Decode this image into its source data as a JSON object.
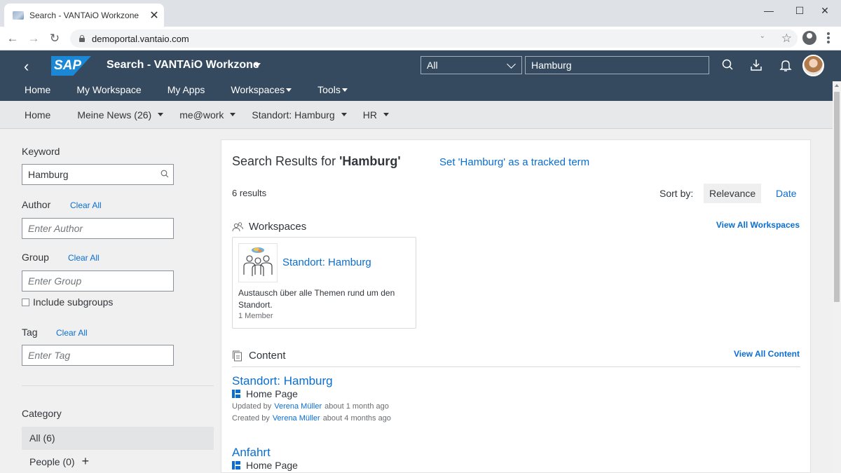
{
  "browser": {
    "tab_title": "Search - VANTAiO Workzone",
    "url": "demoportal.vantaio.com"
  },
  "shell": {
    "title": "Search - VANTAiO Workzone",
    "scope_value": "All",
    "search_value": "Hamburg",
    "logo_text": "SAP",
    "nav": [
      {
        "label": "Home"
      },
      {
        "label": "My Workspace"
      },
      {
        "label": "My Apps"
      },
      {
        "label": "Workspaces"
      },
      {
        "label": "Tools"
      }
    ]
  },
  "subnav": [
    {
      "label": "Home"
    },
    {
      "label": "Meine News (26)"
    },
    {
      "label": "me@work"
    },
    {
      "label": "Standort: Hamburg"
    },
    {
      "label": "HR"
    }
  ],
  "filters": {
    "keyword_label": "Keyword",
    "keyword_value": "Hamburg",
    "author_label": "Author",
    "author_placeholder": "Enter Author",
    "group_label": "Group",
    "group_placeholder": "Enter Group",
    "include_subgroups": "Include subgroups",
    "tag_label": "Tag",
    "tag_placeholder": "Enter Tag",
    "clear_all": "Clear All",
    "category_label": "Category",
    "categories": [
      {
        "label": "All (6)"
      },
      {
        "label": "People (0)"
      }
    ]
  },
  "results": {
    "title_prefix": "Search Results for",
    "term": "'Hamburg'",
    "track_link": "Set 'Hamburg' as a tracked term",
    "count": "6 results",
    "sort_by": "Sort by:",
    "sort_relevance": "Relevance",
    "sort_date": "Date",
    "workspaces_title": "Workspaces",
    "view_all_workspaces": "View All Workspaces",
    "workspace": {
      "name": "Standort: Hamburg",
      "description": "Austausch über alle Themen rund um den Standort.",
      "members": "1 Member"
    },
    "content_title": "Content",
    "view_all_content": "View All Content",
    "items": [
      {
        "title": "Standort: Hamburg",
        "type": "Home Page",
        "updated_by": "Updated by",
        "updated_user": "Verena Müller",
        "updated_when": "about 1 month ago",
        "created_by": "Created by",
        "created_user": "Verena Müller",
        "created_when": "about 4 months ago"
      },
      {
        "title": "Anfahrt",
        "type": "Home Page"
      }
    ]
  },
  "colors": {
    "shell_bg": "#354a5f",
    "link": "#0a6ed1",
    "sap_blue": "#1a88d6"
  }
}
